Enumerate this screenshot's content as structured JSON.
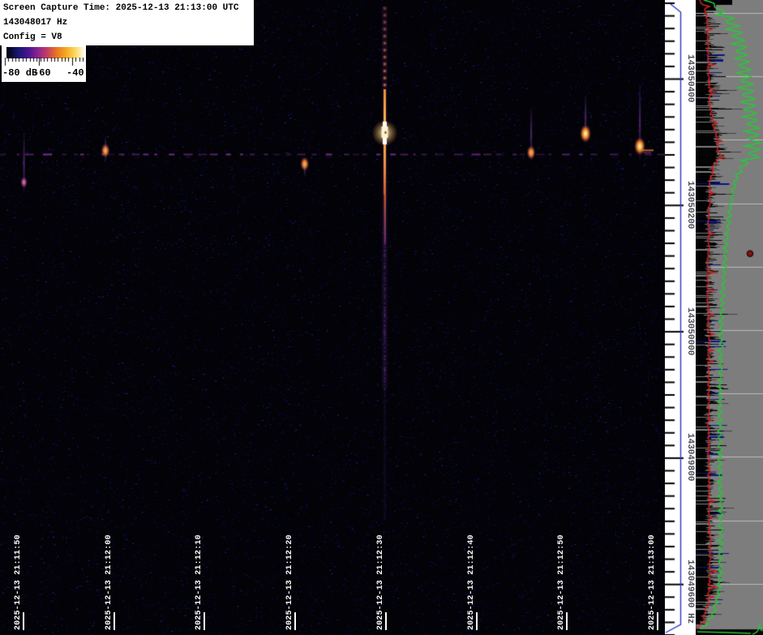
{
  "header": {
    "line1": "Screen Capture Time: 2025-12-13 21:13:00 UTC",
    "line2": "143048017 Hz",
    "line3": "Config = V8"
  },
  "chart_data": {
    "type": "heatmap",
    "subtype": "radio spectrogram waterfall (time x frequency, power as color)",
    "capture_time_utc": "2025-12-13 21:13:00 UTC",
    "tuned_frequency_hz": 143048017,
    "config": "V8",
    "x_axis": {
      "label": "time (UTC)",
      "tick_interval_s": 10,
      "tick_labels": [
        "2025-12-13 21:11:50",
        "2025-12-13 21:12:00",
        "2025-12-13 21:12:10",
        "2025-12-13 21:12:20",
        "2025-12-13 21:12:30",
        "2025-12-13 21:12:40",
        "2025-12-13 21:12:50",
        "2025-12-13 21:13:00"
      ]
    },
    "y_axis": {
      "label": "frequency (Hz)",
      "tick_interval_hz": 200,
      "tick_labels": [
        "143050400",
        "143050200",
        "143050000",
        "143049800",
        "143049600 Hz"
      ],
      "tick_values_hz": [
        143050400,
        143050200,
        143050000,
        143049800,
        143049600
      ],
      "visible_range_hz": [
        143049525,
        143050525
      ]
    },
    "color_scale": {
      "unit": "dB",
      "min_db": -80,
      "max_db": -40,
      "tick_labels": [
        "-80 dB",
        "-60",
        "-40"
      ],
      "colormap_stops": [
        {
          "color": "#000006",
          "pos": 0
        },
        {
          "color": "#16166e",
          "pos": 0.14
        },
        {
          "color": "#4a1490",
          "pos": 0.28
        },
        {
          "color": "#8c2490",
          "pos": 0.4
        },
        {
          "color": "#c43e64",
          "pos": 0.52
        },
        {
          "color": "#e87820",
          "pos": 0.64
        },
        {
          "color": "#f4aa26",
          "pos": 0.76
        },
        {
          "color": "#fbd75c",
          "pos": 0.87
        },
        {
          "color": "#ffffff",
          "pos": 1
        }
      ]
    },
    "carrier_line_hz": 143050280,
    "carrier_color": "#9e3eb2",
    "bracket_color": "#2a35c8",
    "main_event": {
      "time_utc": "21:12:30",
      "freq_span_hz": [
        143050514,
        143049910
      ],
      "fade_end_hz": 143049700,
      "core_span_hz": [
        143050332,
        143050296
      ],
      "description": "strong overdense meteor echo with wide Doppler spread and saturated white core"
    },
    "events": [
      {
        "time_utc": "21:11:50",
        "freq_hz": 143050236,
        "streak_span_hz": [
          143050313,
          143050220
        ],
        "intensity": "faint"
      },
      {
        "time_utc": "21:11:59",
        "freq_hz": 143050286,
        "streak_span_hz": [
          143050309,
          143050268
        ],
        "intensity": "medium"
      },
      {
        "time_utc": "21:12:21",
        "freq_hz": 143050265,
        "streak_span_hz": [
          143050272,
          143050245
        ],
        "intensity": "medium"
      },
      {
        "time_utc": "21:12:46",
        "freq_hz": 143050283,
        "streak_span_hz": [
          143050355,
          143050272
        ],
        "intensity": "medium"
      },
      {
        "time_utc": "21:12:52",
        "freq_hz": 143050313,
        "streak_span_hz": [
          143050373,
          143050305
        ],
        "intensity": "bright"
      },
      {
        "time_utc": "21:12:58",
        "freq_hz": 143050293,
        "streak_span_hz": [
          143050390,
          143050272
        ],
        "intensity": "bright",
        "tail_right": true
      }
    ],
    "side_spectrum": {
      "background_color": "#7d7d7d",
      "gridline_color": "#bcbcbc",
      "traces": [
        {
          "name": "current spectrum",
          "style": "filled bars",
          "color": "#000000"
        },
        {
          "name": "interference spikes",
          "style": "bars",
          "color": "#0a1680"
        },
        {
          "name": "average spectrum",
          "style": "line",
          "color": "#cc2020"
        },
        {
          "name": "peak spectrum",
          "style": "line",
          "color": "#28c838"
        }
      ],
      "marker_dot": {
        "color": "#8c1212",
        "freq_hz": 143050123
      }
    }
  }
}
